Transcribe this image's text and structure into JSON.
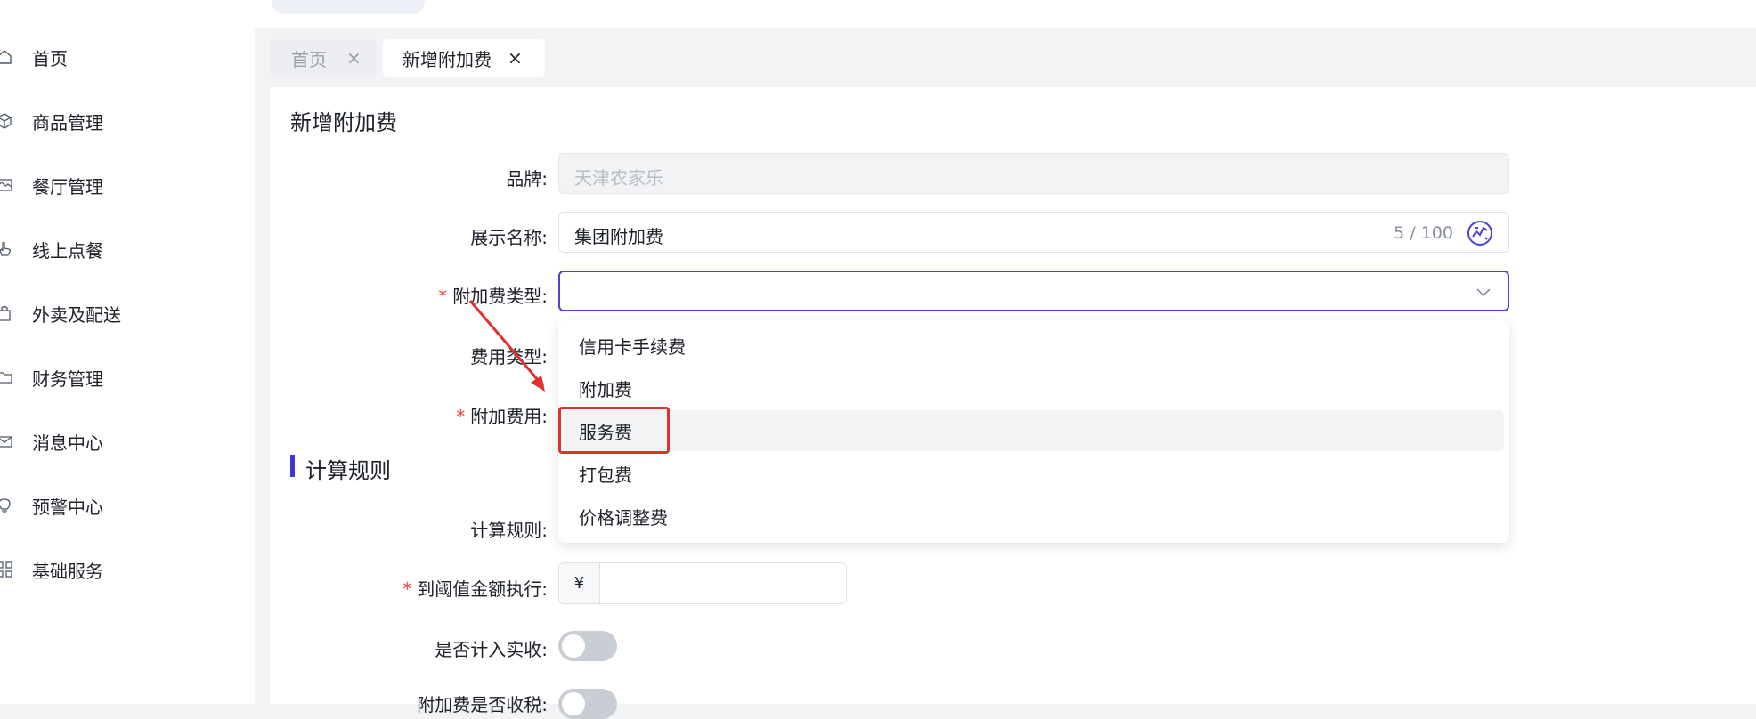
{
  "sidebar": {
    "items": [
      {
        "label": "首页",
        "icon": "home-icon"
      },
      {
        "label": "商品管理",
        "icon": "cube-icon"
      },
      {
        "label": "餐厅管理",
        "icon": "store-icon"
      },
      {
        "label": "线上点餐",
        "icon": "hand-pointer-icon"
      },
      {
        "label": "外卖及配送",
        "icon": "bag-icon"
      },
      {
        "label": "财务管理",
        "icon": "folder-icon"
      },
      {
        "label": "消息中心",
        "icon": "mail-icon"
      },
      {
        "label": "预警中心",
        "icon": "bulb-icon"
      },
      {
        "label": "基础服务",
        "icon": "grid-icon"
      }
    ]
  },
  "tabs": [
    {
      "label": "首页",
      "close": "×"
    },
    {
      "label": "新增附加费",
      "close": "×"
    }
  ],
  "page": {
    "title": "新增附加费"
  },
  "form": {
    "brand": {
      "label": "品牌:",
      "value": "天津农家乐"
    },
    "display_name": {
      "label": "展示名称:",
      "value": "集团附加费",
      "count": "5 / 100"
    },
    "surcharge_type": {
      "label": "附加费类型:",
      "value": ""
    },
    "fee_type": {
      "label": "费用类型:"
    },
    "surcharge_amount": {
      "label": "附加费用:"
    },
    "section_title": "计算规则",
    "calc_rule": {
      "label": "计算规则:"
    },
    "threshold": {
      "label": "到阈值金额执行:",
      "prefix": "¥",
      "value": ""
    },
    "include_actual": {
      "label": "是否计入实收:"
    },
    "taxable": {
      "label": "附加费是否收税:"
    }
  },
  "dropdown": {
    "options": [
      "信用卡手续费",
      "附加费",
      "服务费",
      "打包费",
      "价格调整费"
    ],
    "highlighted": "服务费"
  },
  "colors": {
    "accent": "#4b43d8",
    "required": "#f53f3f",
    "annotation": "#e0312c"
  }
}
